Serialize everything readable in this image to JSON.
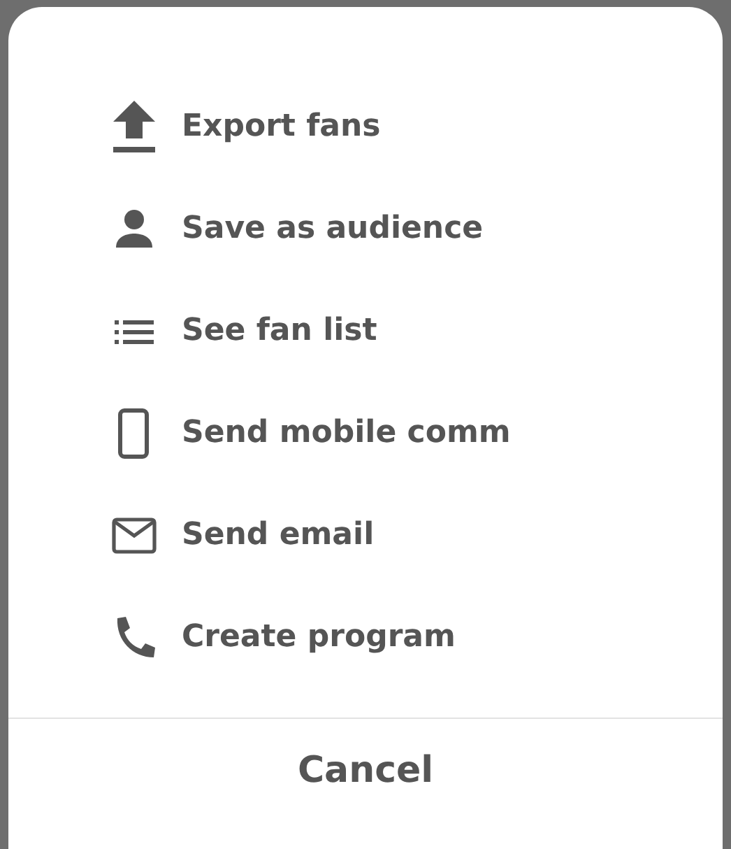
{
  "actions": [
    {
      "kind": "upload",
      "label": "Export fans"
    },
    {
      "kind": "person",
      "label": "Save as audience"
    },
    {
      "kind": "list",
      "label": "See fan list"
    },
    {
      "kind": "mobile",
      "label": "Send mobile comm"
    },
    {
      "kind": "mail",
      "label": "Send email"
    },
    {
      "kind": "phone",
      "label": "Create program"
    }
  ],
  "cancel": "Cancel"
}
